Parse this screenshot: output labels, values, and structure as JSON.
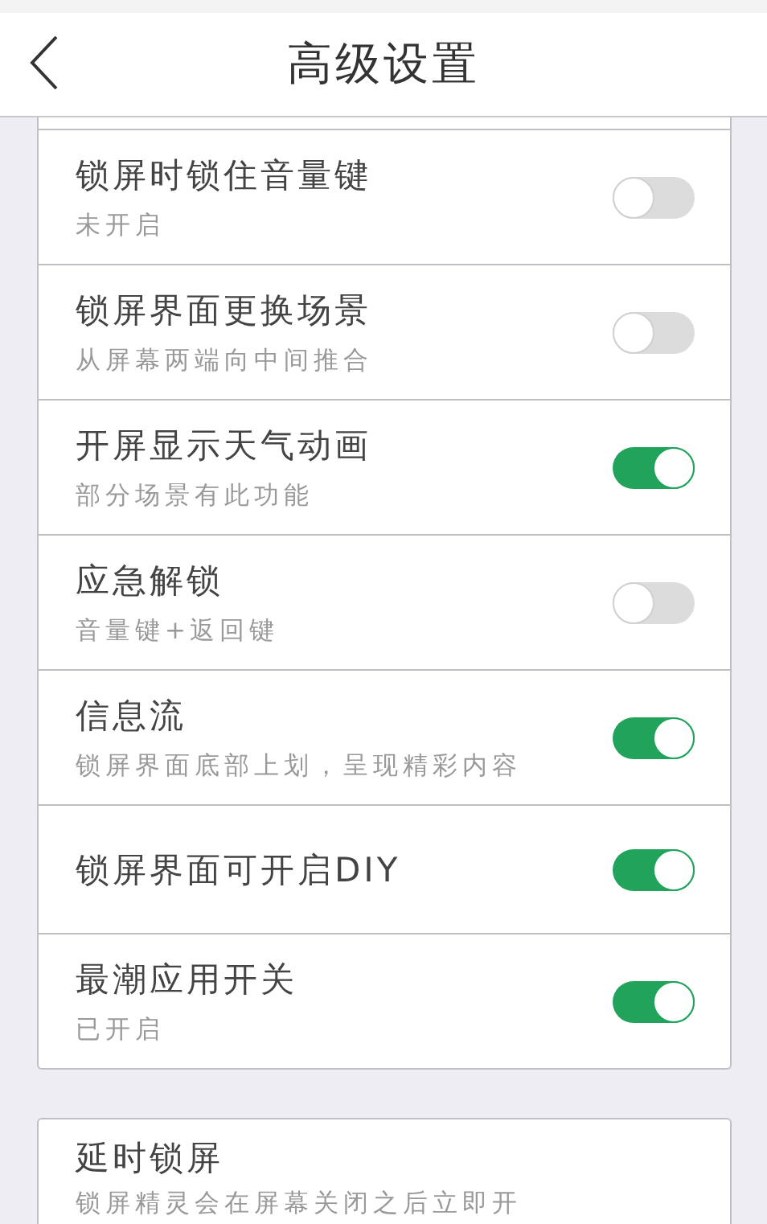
{
  "header": {
    "title": "高级设置"
  },
  "sections": [
    {
      "rows": [
        {
          "title": "锁屏时锁住音量键",
          "subtitle": "未开启",
          "on": false
        },
        {
          "title": "锁屏界面更换场景",
          "subtitle": "从屏幕两端向中间推合",
          "on": false
        },
        {
          "title": "开屏显示天气动画",
          "subtitle": "部分场景有此功能",
          "on": true
        },
        {
          "title": "应急解锁",
          "subtitle": "音量键+返回键",
          "on": false
        },
        {
          "title": "信息流",
          "subtitle": "锁屏界面底部上划，呈现精彩内容",
          "on": true
        },
        {
          "title": "锁屏界面可开启DIY",
          "on": true
        },
        {
          "title": "最潮应用开关",
          "subtitle": "已开启",
          "on": true
        }
      ]
    },
    {
      "rows": [
        {
          "title": "延时锁屏",
          "subtitle": "锁屏精灵会在屏幕关闭之后立即开"
        }
      ]
    }
  ]
}
